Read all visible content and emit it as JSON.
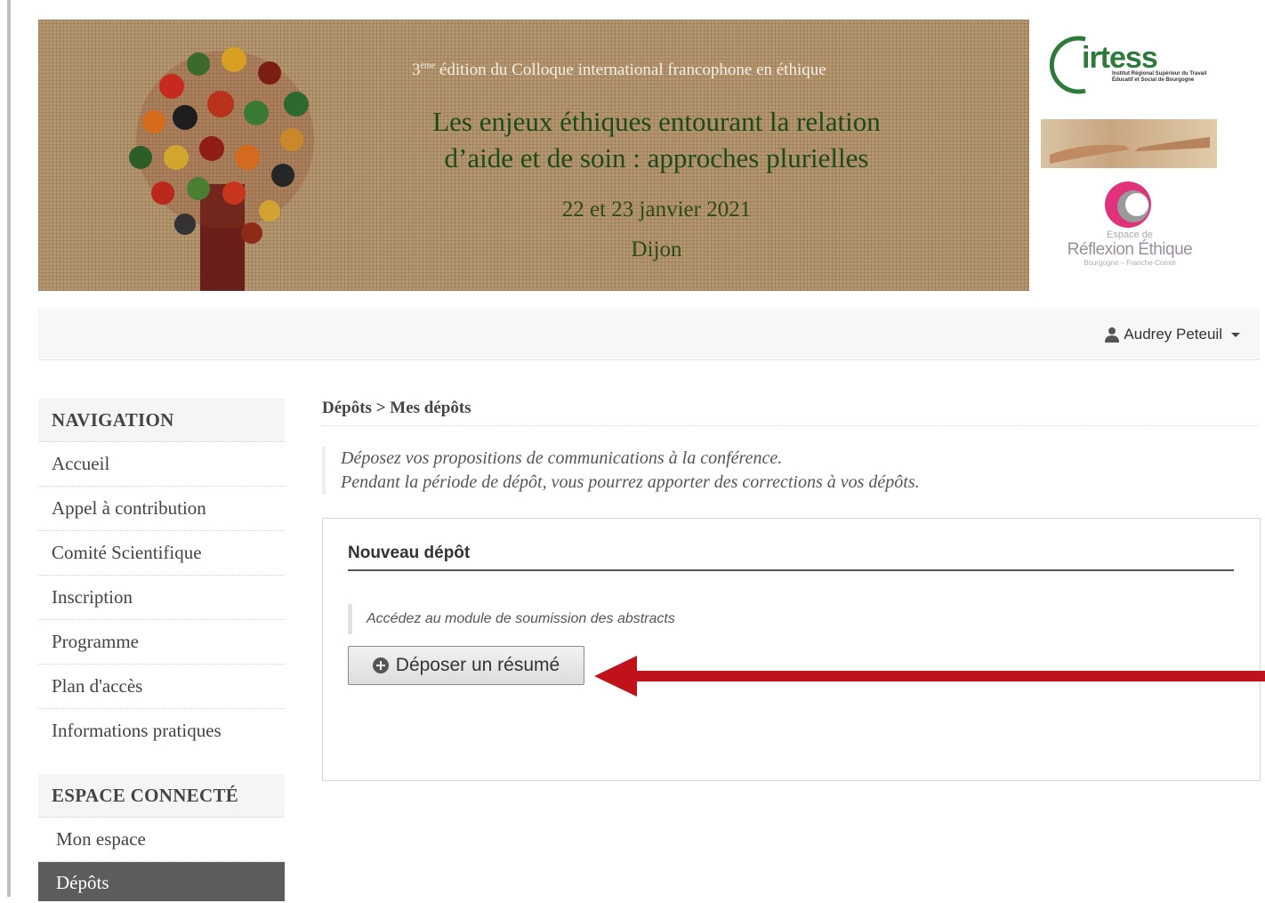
{
  "banner": {
    "edition_prefix": "3",
    "edition_sup": "ème",
    "edition_text": "édition du Colloque international francophone en éthique",
    "title_line1": "Les enjeux éthiques entourant la relation",
    "title_line2": "d’aide et de soin : approches plurielles",
    "dates": "22 et 23 janvier 2021",
    "city": "Dijon"
  },
  "logos": {
    "irtess_name": "irtess",
    "irtess_subtitle": "Institut Régional Supérieur du Travail Éducatif et Social de Bourgogne",
    "ere_top": "Espace de",
    "ere_main": "Réflexion Éthique",
    "ere_bottom": "Bourgogne – Franche-Comté"
  },
  "navbar": {
    "user_name": "Audrey Peteuil"
  },
  "sidebar": {
    "navigation_heading": "NAVIGATION",
    "nav_items": [
      "Accueil",
      "Appel à contribution",
      "Comité Scientifique",
      "Inscription",
      "Programme",
      "Plan d'accès",
      "Informations pratiques"
    ],
    "connected_heading": "ESPACE CONNECTÉ",
    "connected_items": [
      "Mon espace",
      "Dépôts"
    ]
  },
  "main": {
    "breadcrumb": "Dépôts > Mes dépôts",
    "note_line1": "Déposez vos propositions de communications à la conférence.",
    "note_line2": "Pendant la période de dépôt, vous pourrez apporter des corrections à vos dépôts.",
    "panel_title": "Nouveau dépôt",
    "panel_note": "Accédez au module de soumission des abstracts",
    "submit_button": "Déposer un résumé"
  },
  "colors": {
    "accent_arrow": "#c0121b",
    "active_item_bg": "#5c5c5c",
    "banner_title": "#1e4a18"
  }
}
